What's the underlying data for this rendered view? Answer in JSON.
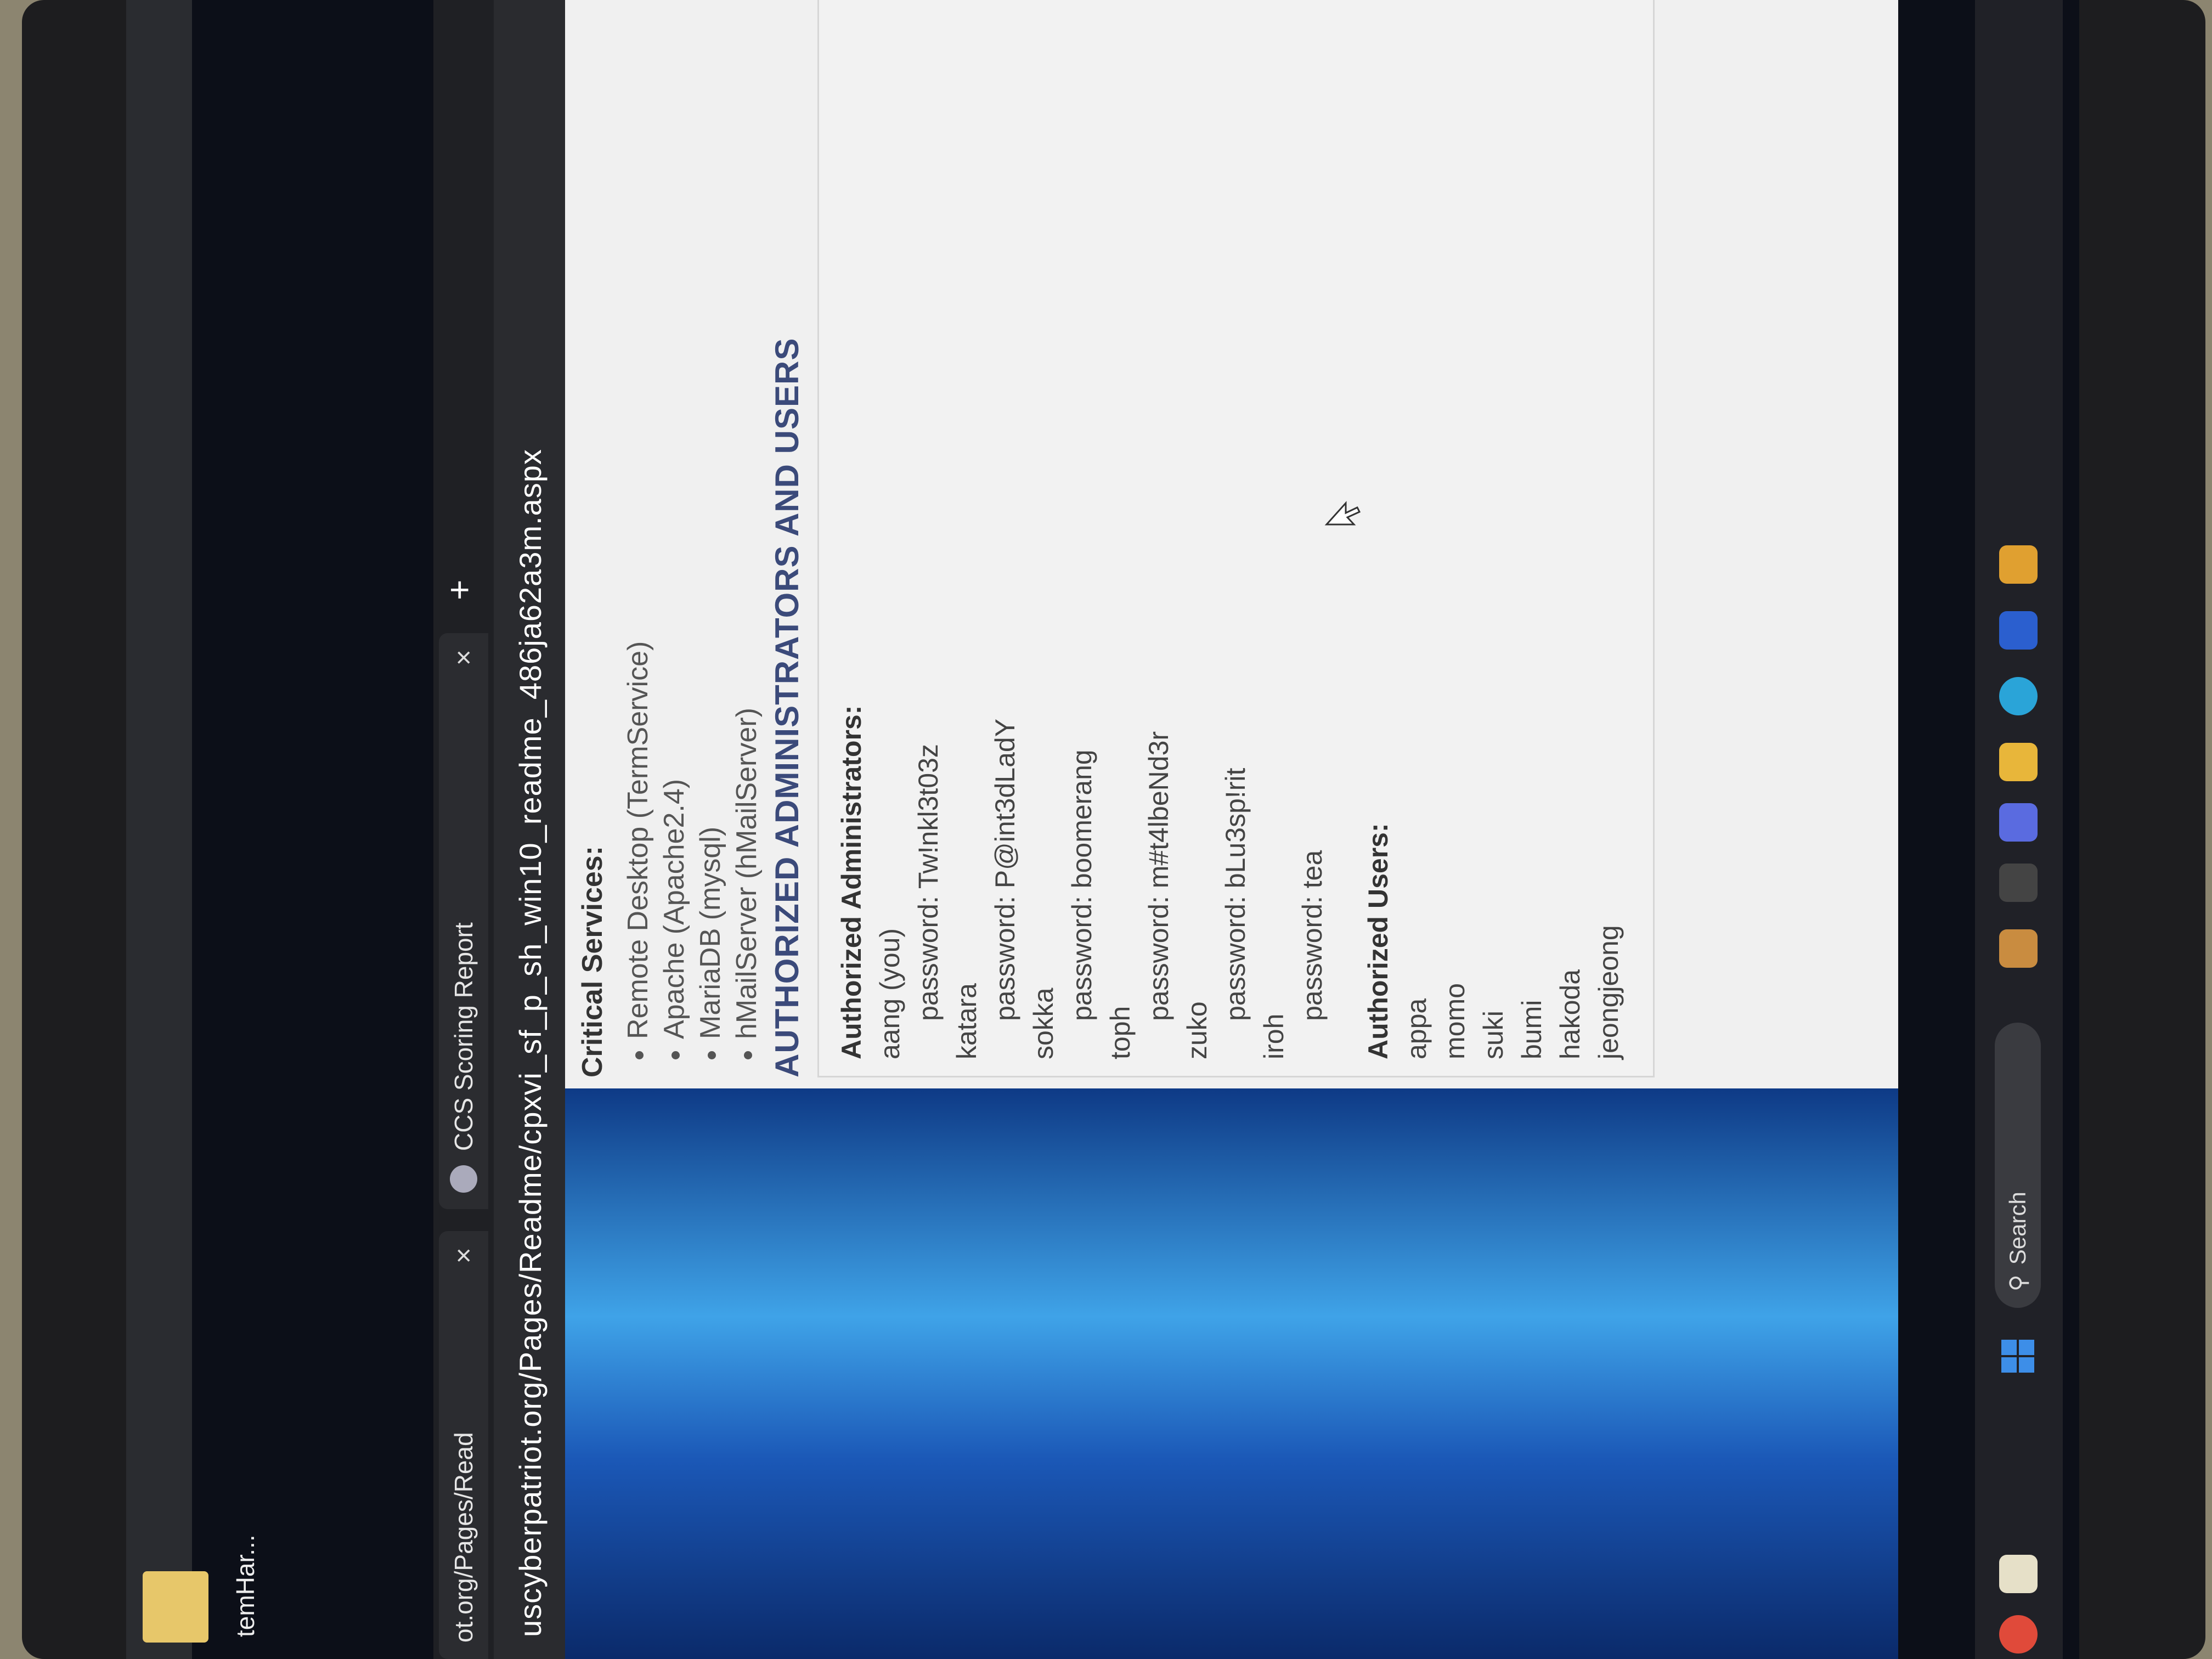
{
  "desktop": {
    "shortcut_label": "temHar..."
  },
  "browser": {
    "tabs": [
      {
        "label": "ot.org/Pages/Read",
        "close": "×"
      },
      {
        "label": "CCS Scoring Report",
        "close": "×"
      }
    ],
    "new_tab": "+",
    "url": "uscyberpatriot.org/Pages/Readme/cpxvi_sf_p_sh_win10_readme_486ja62a3m.aspx"
  },
  "page": {
    "critical_services_title": "Critical Services:",
    "critical_services": [
      "Remote Desktop (TermService)",
      "Apache (Apache2.4)",
      "MariaDB (mysql)",
      "hMailServer (hMailServer)"
    ],
    "section_title": "AUTHORIZED ADMINISTRATORS AND USERS",
    "admins_title": "Authorized Administrators:",
    "admins": [
      {
        "name": "aang (you)",
        "password": "password: Tw!nkl3t03z"
      },
      {
        "name": "katara",
        "password": "password: P@int3dLadY"
      },
      {
        "name": "sokka",
        "password": "password: boomerang"
      },
      {
        "name": "toph",
        "password": "password: m#t4lbeNd3r"
      },
      {
        "name": "zuko",
        "password": "password: bLu3sp!rit"
      },
      {
        "name": "iroh",
        "password": "password: tea"
      }
    ],
    "users_title": "Authorized Users:",
    "users": [
      "appa",
      "momo",
      "suki",
      "bumi",
      "hakoda",
      "jeongjeong"
    ]
  },
  "taskbar": {
    "search_placeholder": "Search"
  },
  "colors": {
    "accent": "#3b4a7a",
    "taskbar": "#202127",
    "tabbar": "#1f2024"
  }
}
